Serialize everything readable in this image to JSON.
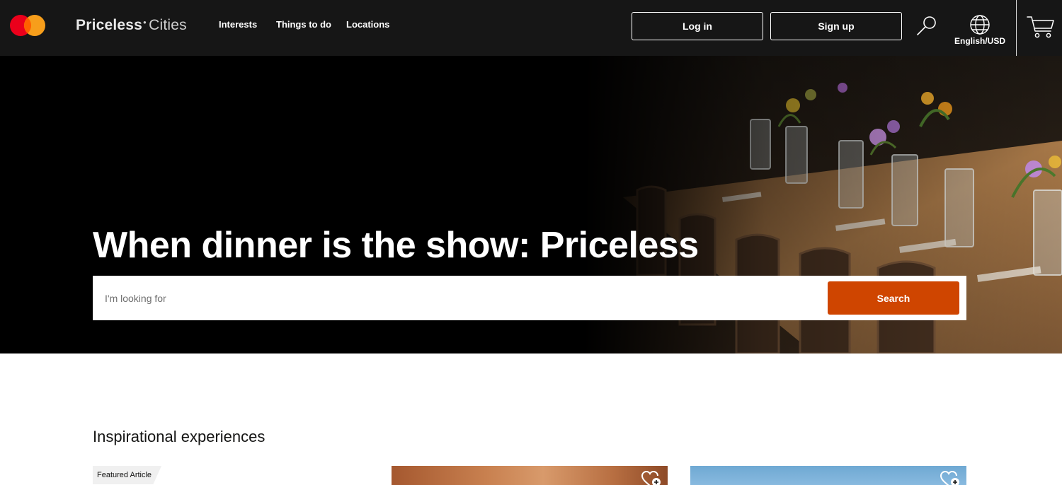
{
  "header": {
    "brand_primary": "Priceless",
    "brand_secondary": "Cities",
    "nav": [
      "Interests",
      "Things to do",
      "Locations"
    ],
    "login_label": "Log in",
    "signup_label": "Sign up",
    "language_label": "English/USD"
  },
  "hero": {
    "title": "When dinner is the show: Priceless",
    "search_placeholder": "I'm looking for",
    "search_button": "Search"
  },
  "section": {
    "title": "Inspirational experiences"
  },
  "cards": [
    {
      "tag": "Featured Article"
    },
    {
      "tag": ""
    },
    {
      "tag": ""
    }
  ],
  "colors": {
    "header_bg": "#161616",
    "accent": "#cf4500",
    "mastercard_red": "#eb001b",
    "mastercard_orange": "#f79e1b"
  },
  "icons": [
    "mastercard-logo",
    "search-icon",
    "globe-icon",
    "cart-icon",
    "heart-plus-icon"
  ]
}
